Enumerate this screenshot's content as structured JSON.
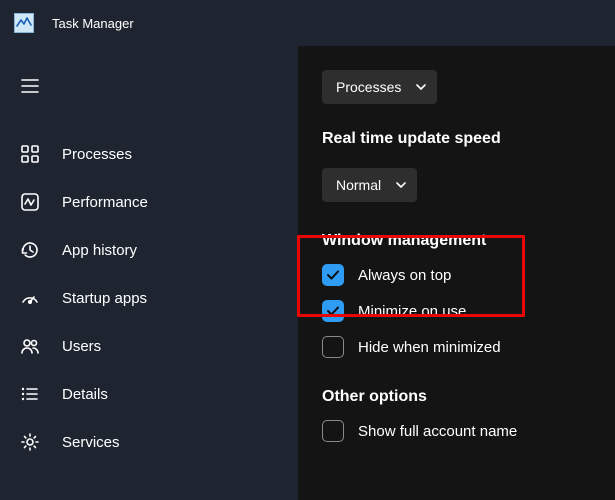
{
  "title": "Task Manager",
  "sidebar": {
    "items": [
      {
        "label": "Processes"
      },
      {
        "label": "Performance"
      },
      {
        "label": "App history"
      },
      {
        "label": "Startup apps"
      },
      {
        "label": "Users"
      },
      {
        "label": "Details"
      },
      {
        "label": "Services"
      }
    ]
  },
  "settings": {
    "default_page_dropdown": "Processes",
    "speed_header": "Real time update speed",
    "speed_dropdown": "Normal",
    "window_mgmt_header": "Window management",
    "always_on_top": "Always on top",
    "minimize_on_use": "Minimize on use",
    "hide_when_min": "Hide when minimized",
    "other_options_header": "Other options",
    "show_full_account": "Show full account name"
  }
}
